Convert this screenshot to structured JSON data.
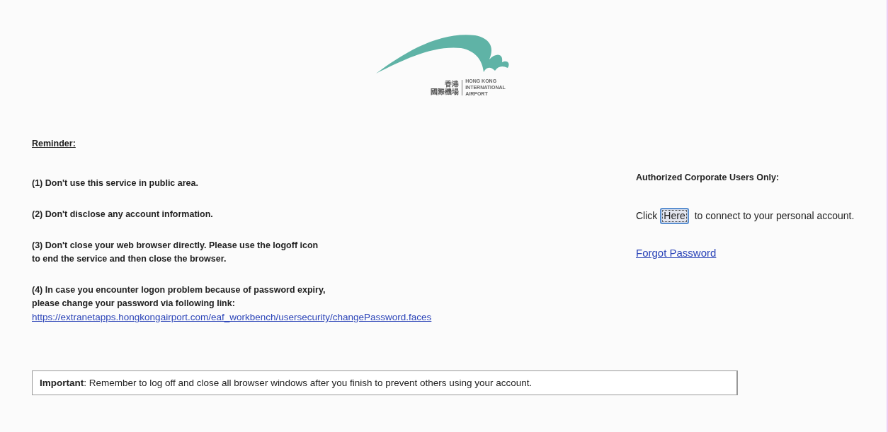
{
  "logo": {
    "chinese": [
      "香港",
      "國際機場"
    ],
    "english": [
      "HONG KONG",
      "INTERNATIONAL",
      "AIRPORT"
    ]
  },
  "reminder": {
    "title": "Reminder:",
    "items": [
      {
        "lines": [
          "(1) Don't use this service in public area."
        ]
      },
      {
        "lines": [
          "(2) Don't disclose any account information."
        ]
      },
      {
        "lines": [
          "(3) Don't close your web browser directly. Please use the logoff icon",
          "to end the service and then close the browser."
        ]
      },
      {
        "lines": [
          "(4) In case you encounter logon problem because of password expiry,",
          "please change your password via following link:"
        ],
        "link": "https://extranetapps.hongkongairport.com/eaf_workbench/usersecurity/changePassword.faces"
      }
    ]
  },
  "login": {
    "title": "Authorized Corporate Users Only:",
    "before": "Click",
    "button": "Here",
    "after": "to connect to your personal account.",
    "forgot": "Forgot Password"
  },
  "notice": "**Important**: Remember to log off and close all browser windows after you finish to prevent others using your account."
}
